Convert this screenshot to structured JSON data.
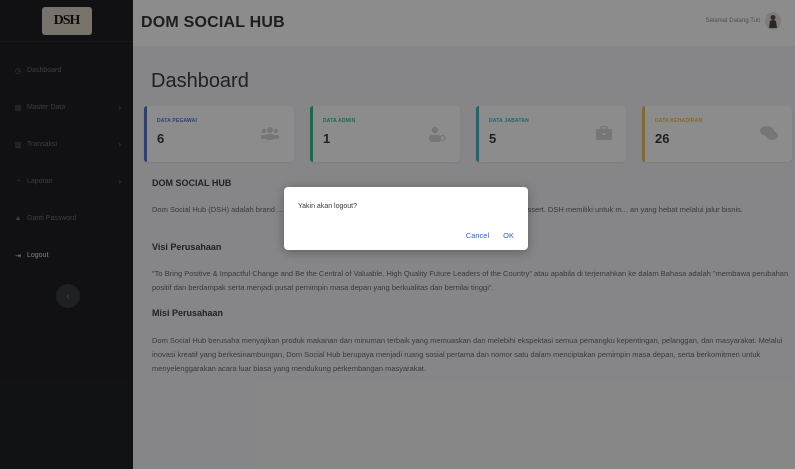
{
  "sidebar": {
    "logo_text": "DSH",
    "items": [
      {
        "label": "Dashboard",
        "icon": "dashboard-icon",
        "glyph": "◷",
        "has_chevron": false
      },
      {
        "label": "Master Data",
        "icon": "database-icon",
        "glyph": "▤",
        "has_chevron": true
      },
      {
        "label": "Transaksi",
        "icon": "transaction-icon",
        "glyph": "▥",
        "has_chevron": true
      },
      {
        "label": "Laporan",
        "icon": "report-icon",
        "glyph": "◔",
        "has_chevron": true
      },
      {
        "label": "Ganti Password",
        "icon": "lock-icon",
        "glyph": "▲",
        "has_chevron": false
      },
      {
        "label": "Logout",
        "icon": "logout-icon",
        "glyph": "⇥",
        "has_chevron": false
      }
    ],
    "chevron_glyph": "›",
    "toggle_glyph": "‹"
  },
  "topbar": {
    "title": "DOM SOCIAL HUB",
    "greeting": "Selamat Datang Tuti"
  },
  "main": {
    "page_title": "Dashboard",
    "cards": [
      {
        "label": "DATA PEGAWAI",
        "value": "6",
        "color": "#4e73df",
        "icon": "users-icon",
        "glyph": "👥"
      },
      {
        "label": "DATA ADMIN",
        "value": "1",
        "color": "#1cc88a",
        "icon": "user-admin-icon",
        "glyph": "👤"
      },
      {
        "label": "DATA JABATAN",
        "value": "5",
        "color": "#36b9cc",
        "icon": "briefcase-icon",
        "glyph": "💼"
      },
      {
        "label": "DATA KEHADIRAN",
        "value": "26",
        "color": "#f6c23e",
        "icon": "comments-icon",
        "glyph": "💬"
      }
    ],
    "about_title": "DOM SOCIAL HUB",
    "about_text": "Dom Social Hub (DSH) adalah brand ... sia, yang berfokus pada bidang kuliner kekinian seperti coffe dan juga dessert. DSH memiliki untuk m... an yang hebat melalui jalur bisnis.",
    "vision_title": "Visi Perusahaan",
    "vision_text": "\"To Bring Positive & Impactful Change and Be the Central of Valuable, High Quality Future Leaders of the Country\" atau apabila di terjemahkan ke dalam Bahasa adalah \"membawa perubahan positif dan berdampak serta menjadi pusat pemimpin masa depan yang berkualitas dan bernilai tinggi\".",
    "mission_title": "Misi Perusahaan",
    "mission_text": "Dom Social Hub berusaha menyajikan produk makanan dan minuman terbaik yang memuaskan dan melebihi ekspektasi semua pemangku kepentingan, pelanggan, dan masyarakat. Melalui inovasi kreatif yang berkesinambungan, Dom Social Hub berupaya menjadi ruang sosial pertama dan nomor satu dalam menciptakan pemimpin masa depan, serta berkomitmen untuk menyelenggarakan acara luar biasa yang mendukung perkembangan masyarakat."
  },
  "dialog": {
    "message": "Yakin akan logout?",
    "cancel_label": "Cancel",
    "ok_label": "OK"
  }
}
